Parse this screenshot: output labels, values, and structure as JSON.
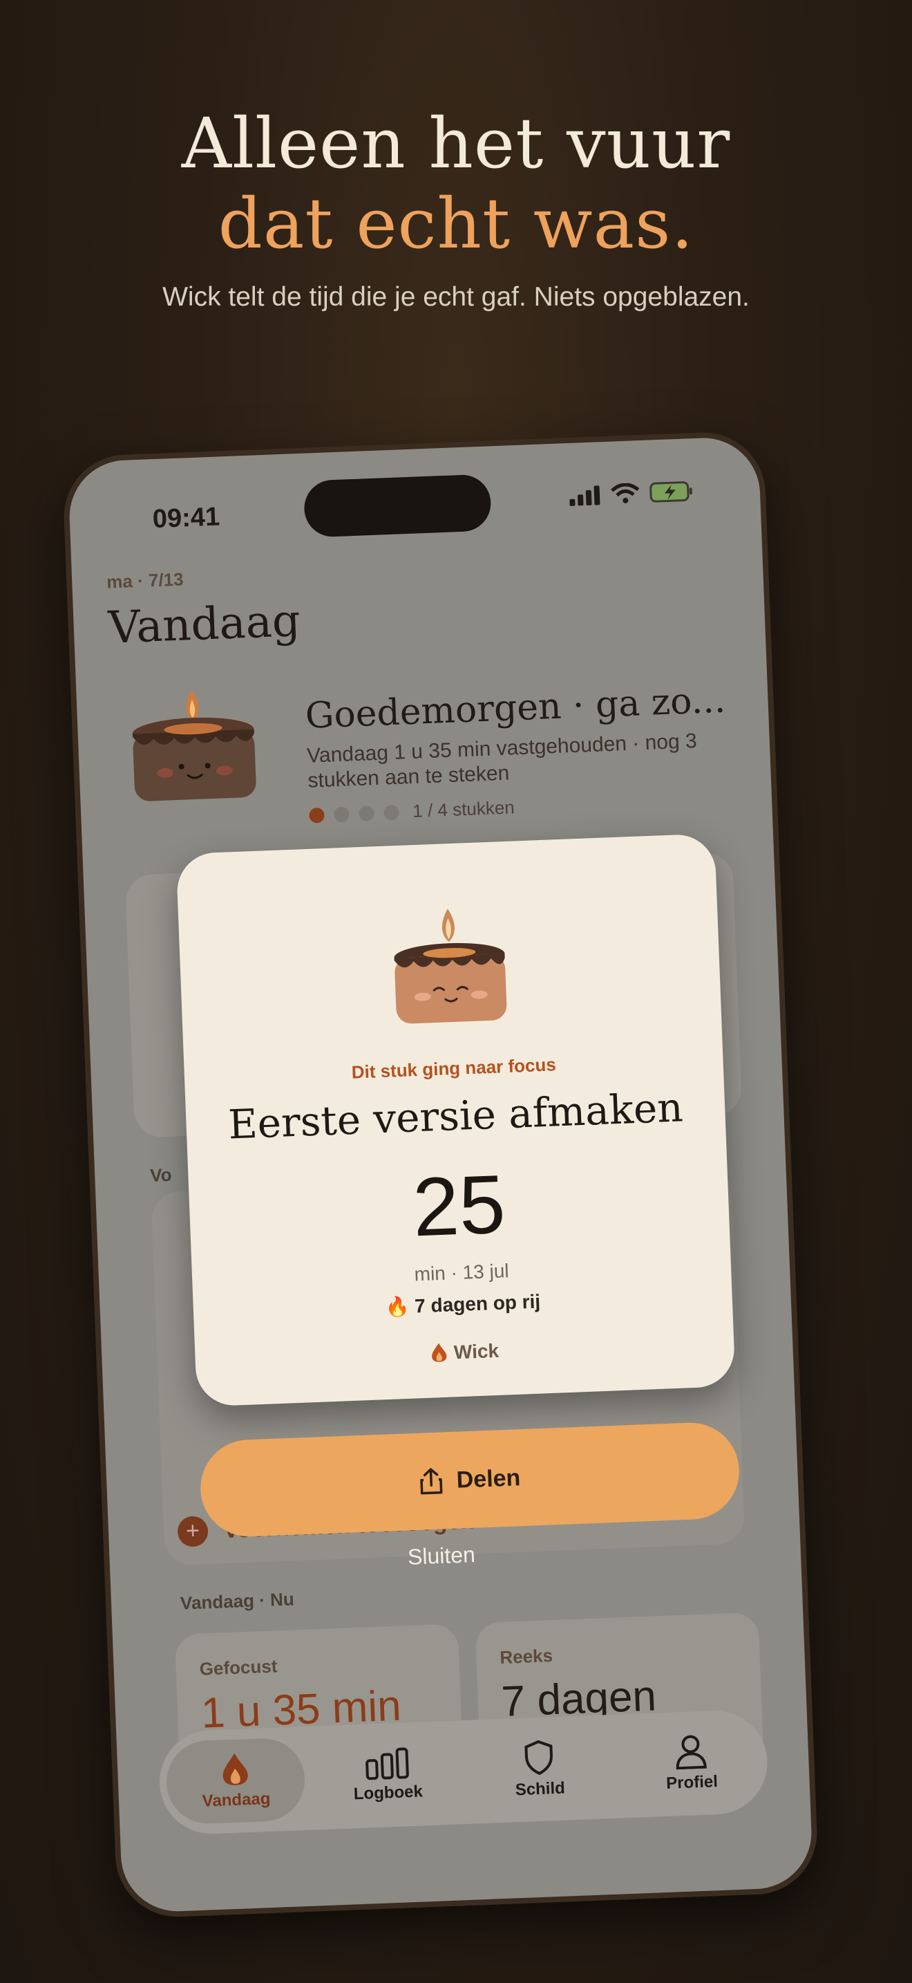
{
  "hero": {
    "line1": "Alleen het vuur",
    "line2": "dat echt was.",
    "subtitle": "Wick telt de tijd die je echt gaf. Niets opgeblazen."
  },
  "status": {
    "time": "09:41"
  },
  "header": {
    "date": "ma · 7/13",
    "title": "Vandaag"
  },
  "greeting": {
    "title": "Goedemorgen · ga zo...",
    "subtitle": "Vandaag 1 u 35 min vastgehouden · nog 3 stukken aan te steken",
    "progress_label": "1 / 4 stukken",
    "pieces_done": 1,
    "pieces_total": 4
  },
  "list": {
    "section_partial": "Vo",
    "add_label": "Voornemen toevoegen"
  },
  "stats": {
    "section": "Vandaag · Nu",
    "focused_label": "Gefocust",
    "focused_value": "1 u 35 min",
    "streak_label": "Reeks",
    "streak_value": "7 dagen"
  },
  "tabs": [
    {
      "label": "Vandaag",
      "icon": "flame-icon",
      "active": true
    },
    {
      "label": "Logboek",
      "icon": "bar-chart-icon",
      "active": false
    },
    {
      "label": "Schild",
      "icon": "shield-icon",
      "active": false
    },
    {
      "label": "Profiel",
      "icon": "person-icon",
      "active": false
    }
  ],
  "modal": {
    "kicker": "Dit stuk ging naar focus",
    "title": "Eerste versie afmaken",
    "minutes": "25",
    "meta": "min · 13 jul",
    "streak": "🔥 7 dagen op rij",
    "brand": "Wick"
  },
  "actions": {
    "share": "Delen",
    "close": "Sluiten"
  },
  "colors": {
    "accent": "#eea25c",
    "ember": "#8b3c18",
    "card": "#f3ecde"
  }
}
